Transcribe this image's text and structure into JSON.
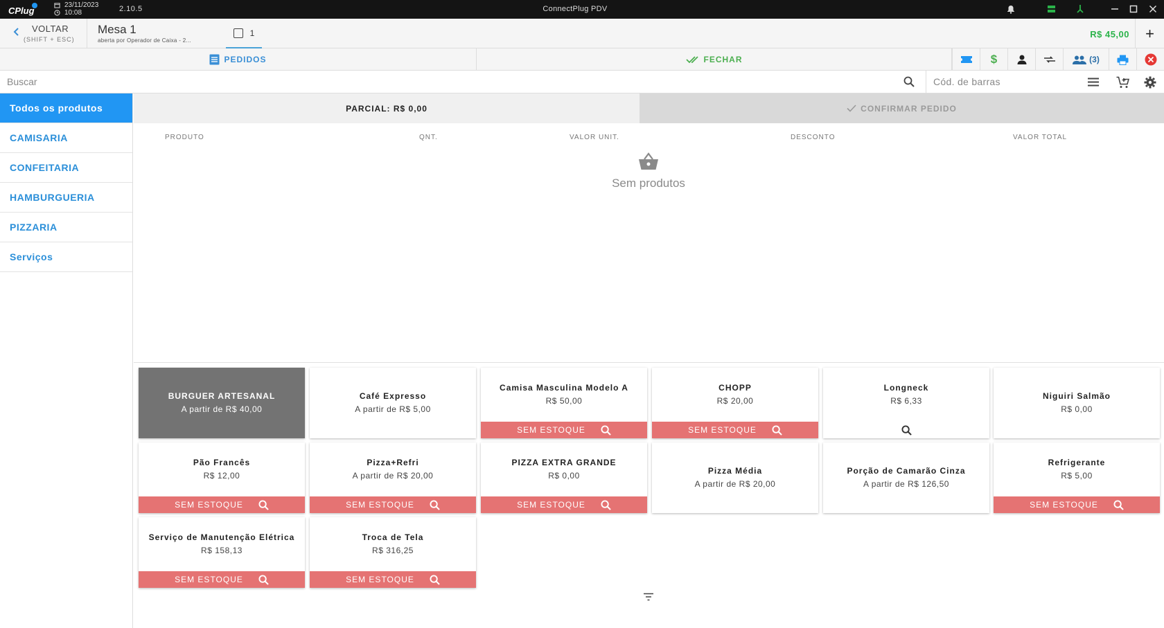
{
  "titlebar": {
    "logo": "CPlug",
    "date": "23/11/2023",
    "time": "10:08",
    "version": "2.10.5",
    "title": "ConnectPlug PDV"
  },
  "header": {
    "back_label": "VOLTAR",
    "back_shortcut": "(SHIFT + ESC)",
    "table_title": "Mesa 1",
    "table_subtitle": "aberta por Operador de Caixa - 2...",
    "seat_number": "1",
    "total": "R$ 45,00",
    "add_symbol": "+"
  },
  "tabs": {
    "pedidos": "PEDIDOS",
    "fechar": "FECHAR",
    "people_count": "(3)"
  },
  "search": {
    "placeholder": "Buscar",
    "barcode_placeholder": "Cód. de barras"
  },
  "categories": [
    "Todos os produtos",
    "CAMISARIA",
    "CONFEITARIA",
    "HAMBURGUERIA",
    "PIZZARIA",
    "Serviços"
  ],
  "order": {
    "parcial": "PARCIAL: R$ 0,00",
    "confirmar": "CONFIRMAR PEDIDO",
    "columns": [
      "PRODUTO",
      "QNT.",
      "VALOR UNIT.",
      "DESCONTO",
      "VALOR TOTAL"
    ],
    "empty": "Sem produtos"
  },
  "stock_label": "SEM ESTOQUE",
  "products": [
    {
      "name": "BURGUER ARTESANAL",
      "price": "A partir de R$ 40,00"
    },
    {
      "name": "Café Expresso",
      "price": "A partir de R$ 5,00"
    },
    {
      "name": "Camisa Masculina Modelo A",
      "price": "R$ 50,00"
    },
    {
      "name": "CHOPP",
      "price": "R$ 20,00"
    },
    {
      "name": "Longneck",
      "price": "R$ 6,33"
    },
    {
      "name": "Niguiri Salmão",
      "price": "R$ 0,00"
    },
    {
      "name": "Pão Francês",
      "price": "R$ 12,00"
    },
    {
      "name": "Pizza+Refri",
      "price": "A partir de R$ 20,00"
    },
    {
      "name": "PIZZA EXTRA GRANDE",
      "price": "R$ 0,00"
    },
    {
      "name": "Pizza Média",
      "price": "A partir de R$ 20,00"
    },
    {
      "name": "Porção de Camarão Cinza",
      "price": "A partir de R$ 126,50"
    },
    {
      "name": "Refrigerante",
      "price": "R$ 5,00"
    },
    {
      "name": "Serviço de Manutenção Elétrica",
      "price": "R$ 158,13"
    },
    {
      "name": "Troca de Tela",
      "price": "R$ 316,25"
    }
  ],
  "colors": {
    "accent": "#2196f3",
    "success": "#4caf50",
    "no_stock": "#e57373",
    "danger": "#e53935"
  }
}
